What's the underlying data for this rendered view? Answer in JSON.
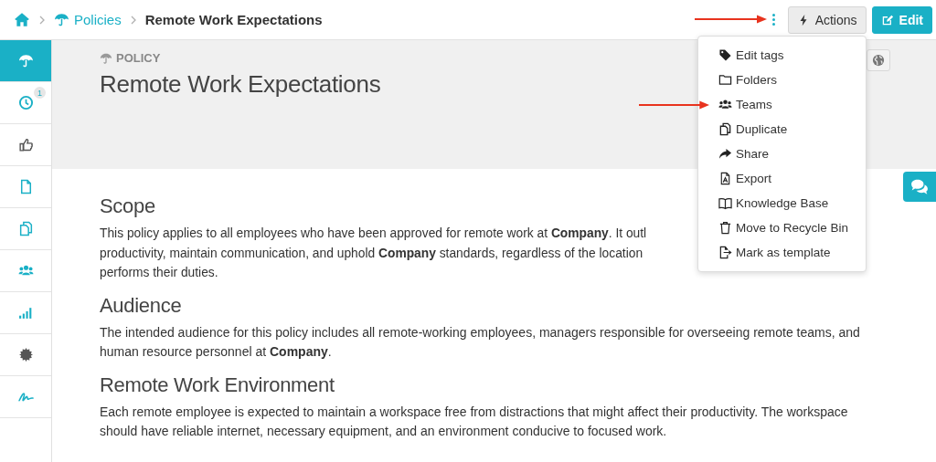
{
  "breadcrumb": [
    {
      "kind": "home"
    },
    {
      "kind": "link",
      "label": "Policies"
    },
    {
      "kind": "current",
      "label": "Remote Work Expectations"
    }
  ],
  "toolbar": {
    "actions": "Actions",
    "edit": "Edit"
  },
  "sidebar": {
    "items": [
      {
        "kind": "umbrella",
        "selected": true
      },
      {
        "kind": "clock",
        "badge": "1",
        "selected": false
      },
      {
        "kind": "thumb",
        "selected": false
      },
      {
        "kind": "file",
        "selected": false
      },
      {
        "kind": "copy",
        "selected": false
      },
      {
        "kind": "users",
        "selected": false
      },
      {
        "kind": "signal",
        "selected": false
      },
      {
        "kind": "gear",
        "selected": false
      },
      {
        "kind": "signature",
        "selected": false
      }
    ]
  },
  "header": {
    "eyebrow": "POLICY",
    "title": "Remote Work Expectations"
  },
  "sections": [
    {
      "heading": "Scope",
      "text": "This policy applies to all employees who have been approved for remote work at **Company**. It outl\nproductivity, maintain communication, and uphold **Company** standards, regardless of the location\nperforms their duties."
    },
    {
      "heading": "Audience",
      "text": "The intended audience for this policy includes all remote-working employees, managers responsible for overseeing remote teams, and human resource personnel at **Company**."
    },
    {
      "heading": "Remote Work Environment",
      "text": "Each remote employee is expected to maintain a workspace free from distractions that might affect their productivity. The workspace should have reliable internet, necessary equipment, and an environment conducive to focused work."
    }
  ],
  "menu": {
    "items": [
      {
        "kind": "tag",
        "label": "Edit tags"
      },
      {
        "kind": "folder",
        "label": "Folders"
      },
      {
        "kind": "users",
        "label": "Teams"
      },
      {
        "kind": "copy",
        "label": "Duplicate"
      },
      {
        "kind": "share",
        "label": "Share"
      },
      {
        "kind": "pdf",
        "label": "Export"
      },
      {
        "kind": "book",
        "label": "Knowledge Base"
      },
      {
        "kind": "trash",
        "label": "Move to Recycle Bin"
      },
      {
        "kind": "template",
        "label": "Mark as template"
      }
    ]
  }
}
